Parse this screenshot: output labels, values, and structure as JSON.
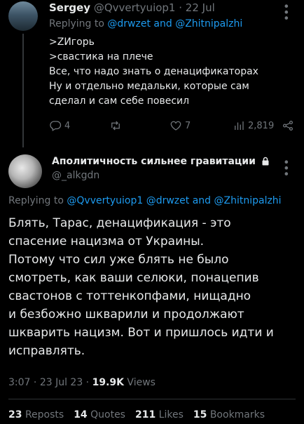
{
  "reply_tweet": {
    "author_name": "Sergey",
    "author_handle": "@Qvvertyuiop1",
    "separator": " · ",
    "date": "22 Jul",
    "replying_prefix": "Replying to ",
    "replying_to_1": "@drwzet",
    "replying_and": " and ",
    "replying_to_2": "@Zhitnipalzhi",
    "lines": [
      ">ZИгорь",
      ">свастика на плече",
      "Все, что надо знать о денацификаторах",
      "Ну и отдельно медальки, которые сам",
      "сделал и сам себе повесил"
    ],
    "actions": {
      "replies": "4",
      "retweets": "",
      "likes": "7",
      "views": "2,819"
    }
  },
  "main_tweet": {
    "author_name": "Аполитичность сильнее гравитации",
    "author_handle": "@_alkgdn",
    "replying_prefix": "Replying to ",
    "replying_to_1": "@Qvvertyuiop1",
    "replying_to_2": "@drwzet",
    "replying_and": " and ",
    "replying_to_3": "@Zhitnipalzhi",
    "lines": [
      "Блять, Тарас, денацификация - это",
      "спасение нацизма от Украины.",
      "Потому что сил уже блять не было",
      "смотреть, как ваши селюки, понацепив",
      "свастонов с тоттенкопфами, нищадно",
      "и безбожно шкварили и продолжают",
      "шкварить нацизм. Вот и пришлось идти и",
      "исправлять."
    ],
    "time": "3:07",
    "date": "23 Jul 23",
    "separator": " · ",
    "views_count": "19.9K",
    "views_label": " Views",
    "stats": {
      "reposts_count": "23",
      "reposts_label": "Reposts",
      "quotes_count": "14",
      "quotes_label": "Quotes",
      "likes_count": "211",
      "likes_label": "Likes",
      "bookmarks_count": "15",
      "bookmarks_label": "Bookmarks"
    }
  },
  "colors": {
    "background": "#000000",
    "text": "#e7e9ea",
    "muted": "#71767b",
    "link": "#1d9bf0"
  }
}
